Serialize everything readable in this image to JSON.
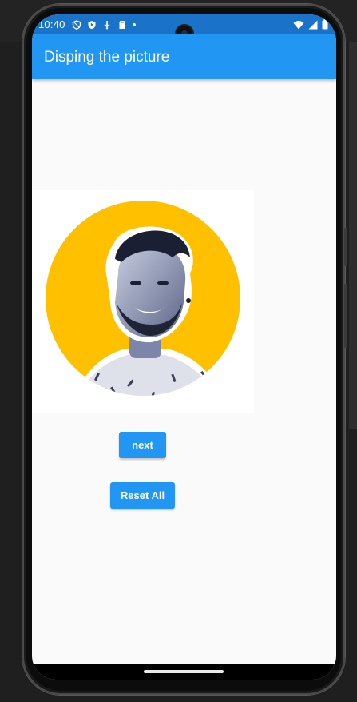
{
  "status": {
    "time": "10:40",
    "left_icons": [
      "shield-outline-icon",
      "play-protect-icon",
      "download-icon",
      "sd-card-icon",
      "notification-dot-icon"
    ],
    "right_icons": [
      "wifi-icon",
      "signal-icon",
      "battery-icon"
    ]
  },
  "appbar": {
    "title": "Disping the picture"
  },
  "picture": {
    "icon": "profile-photo"
  },
  "buttons": {
    "next": "next",
    "reset": "Reset All"
  },
  "colors": {
    "primary": "#2196f3",
    "statusbar": "#1a73c8",
    "background": "#fafafa",
    "photo_ring": "#ffc000"
  }
}
